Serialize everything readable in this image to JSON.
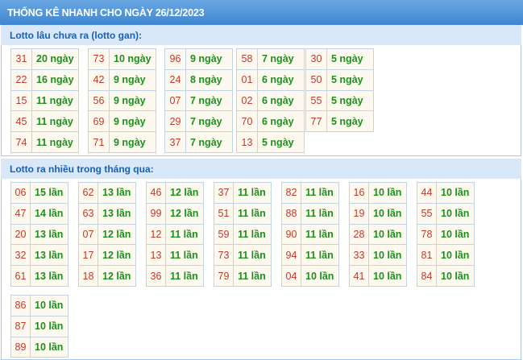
{
  "page_title": "THỐNG KÊ NHANH CHO NGÀY 26/12/2023",
  "gan": {
    "heading": "Lotto lâu chưa ra (lotto gan):",
    "columns": [
      [
        {
          "n": "31",
          "v": "20 ngày"
        },
        {
          "n": "22",
          "v": "16 ngày"
        },
        {
          "n": "15",
          "v": "11 ngày"
        },
        {
          "n": "45",
          "v": "11 ngày"
        },
        {
          "n": "74",
          "v": "11 ngày"
        }
      ],
      [
        {
          "n": "73",
          "v": "10 ngày"
        },
        {
          "n": "42",
          "v": "9 ngày"
        },
        {
          "n": "56",
          "v": "9 ngày"
        },
        {
          "n": "69",
          "v": "9 ngày"
        },
        {
          "n": "71",
          "v": "9 ngày"
        }
      ],
      [
        {
          "n": "96",
          "v": "9 ngày"
        },
        {
          "n": "24",
          "v": "8 ngày"
        },
        {
          "n": "07",
          "v": "7 ngày"
        },
        {
          "n": "29",
          "v": "7 ngày"
        },
        {
          "n": "37",
          "v": "7 ngày"
        }
      ],
      [
        {
          "n": "58",
          "v": "7 ngày"
        },
        {
          "n": "01",
          "v": "6 ngày"
        },
        {
          "n": "02",
          "v": "6 ngày"
        },
        {
          "n": "70",
          "v": "6 ngày"
        },
        {
          "n": "13",
          "v": "5 ngày"
        }
      ],
      [
        {
          "n": "30",
          "v": "5 ngày"
        },
        {
          "n": "50",
          "v": "5 ngày"
        },
        {
          "n": "55",
          "v": "5 ngày"
        },
        {
          "n": "77",
          "v": "5 ngày"
        }
      ]
    ]
  },
  "nhieu": {
    "heading": "Lotto ra nhiều trong tháng qua:",
    "columns": [
      [
        {
          "n": "06",
          "v": "15 lần"
        },
        {
          "n": "47",
          "v": "14 lần"
        },
        {
          "n": "20",
          "v": "13 lần"
        },
        {
          "n": "32",
          "v": "13 lần"
        },
        {
          "n": "61",
          "v": "13 lần"
        }
      ],
      [
        {
          "n": "62",
          "v": "13 lần"
        },
        {
          "n": "63",
          "v": "13 lần"
        },
        {
          "n": "07",
          "v": "12 lần"
        },
        {
          "n": "17",
          "v": "12 lần"
        },
        {
          "n": "18",
          "v": "12 lần"
        }
      ],
      [
        {
          "n": "46",
          "v": "12 lần"
        },
        {
          "n": "99",
          "v": "12 lần"
        },
        {
          "n": "12",
          "v": "11 lần"
        },
        {
          "n": "13",
          "v": "11 lần"
        },
        {
          "n": "36",
          "v": "11 lần"
        }
      ],
      [
        {
          "n": "37",
          "v": "11 lần"
        },
        {
          "n": "51",
          "v": "11 lần"
        },
        {
          "n": "59",
          "v": "11 lần"
        },
        {
          "n": "73",
          "v": "11 lần"
        },
        {
          "n": "79",
          "v": "11 lần"
        }
      ],
      [
        {
          "n": "82",
          "v": "11 lần"
        },
        {
          "n": "88",
          "v": "11 lần"
        },
        {
          "n": "90",
          "v": "11 lần"
        },
        {
          "n": "94",
          "v": "11 lần"
        },
        {
          "n": "04",
          "v": "10 lần"
        }
      ],
      [
        {
          "n": "16",
          "v": "10 lần"
        },
        {
          "n": "19",
          "v": "10 lần"
        },
        {
          "n": "28",
          "v": "10 lần"
        },
        {
          "n": "33",
          "v": "10 lần"
        },
        {
          "n": "41",
          "v": "10 lần"
        }
      ],
      [
        {
          "n": "44",
          "v": "10 lần"
        },
        {
          "n": "55",
          "v": "10 lần"
        },
        {
          "n": "78",
          "v": "10 lần"
        },
        {
          "n": "81",
          "v": "10 lần"
        },
        {
          "n": "84",
          "v": "10 lần"
        }
      ],
      [
        {
          "n": "86",
          "v": "10 lần"
        },
        {
          "n": "87",
          "v": "10 lần"
        },
        {
          "n": "89",
          "v": "10 lần"
        }
      ]
    ]
  }
}
